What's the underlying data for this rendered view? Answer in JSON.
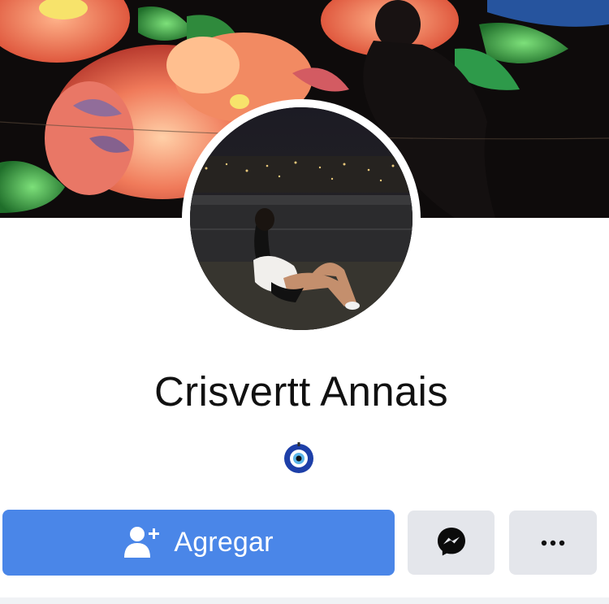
{
  "profile": {
    "name": "Crisvertt Annais",
    "badge_icon": "nazar-eye-icon"
  },
  "actions": {
    "add_label": "Agregar",
    "add_icon": "add-friend-icon",
    "messenger_icon": "messenger-icon",
    "more_icon": "more-options-icon"
  },
  "colors": {
    "primary_button": "#4a86e8",
    "secondary_button": "#e4e6eb",
    "name_text": "#111111"
  }
}
